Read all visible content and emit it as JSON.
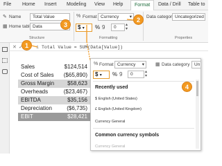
{
  "tabs": [
    "File",
    "Home",
    "Insert",
    "Modeling",
    "View",
    "Help",
    "Format",
    "Data / Drill",
    "Table to"
  ],
  "ribbon": {
    "name_label": "Name",
    "name_value": "Total Value",
    "home_table_label": "Home table",
    "home_table_value": "Data",
    "structure_label": "Structure",
    "format_label": "Format",
    "format_value": "Currency",
    "format_symbol": "$",
    "percent_symbol": "%",
    "comma_symbol": "9",
    "decimals_value": "0",
    "formatting_label": "Formatting",
    "category_label": "Data category",
    "category_value": "Uncategorized",
    "properties_label": "Properties"
  },
  "formula": {
    "line_number": "1",
    "text": "Total Value = SUM(Data[Value])"
  },
  "financials": [
    {
      "label": "Sales",
      "value": "$124,514",
      "style": "normal"
    },
    {
      "label": "Cost of Sales",
      "value": "($65,890)",
      "style": "normal"
    },
    {
      "label": "Gross Margin",
      "value": "$58,623",
      "style": "highlight"
    },
    {
      "label": "Overheads",
      "value": "($23,467)",
      "style": "normal"
    },
    {
      "label": "EBITDA",
      "value": "$35,156",
      "style": "highlight"
    },
    {
      "label": "Depreciation",
      "value": "($6,735)",
      "style": "normal"
    },
    {
      "label": "EBIT",
      "value": "$28,421",
      "style": "dark"
    }
  ],
  "callouts": [
    "1",
    "2",
    "3",
    "4"
  ],
  "panel": {
    "format_label": "Format",
    "format_value": "Currency",
    "category_label": "Data category",
    "category_value": "Un",
    "currency_symbol": "$",
    "percent_symbol": "%",
    "comma_symbol": "9",
    "decimals_value": "0",
    "recently_used_title": "Recently used",
    "recent_items": [
      "$ English (United States)",
      "£ English (United Kingdom)",
      "Currency General"
    ],
    "common_title": "Common currency symbols",
    "common_items": [
      "Currency General"
    ]
  },
  "colors": {
    "accent_orange": "#f39a21",
    "highlight_gray": "#d6d6d6",
    "ebit_gray": "#9a9a9a"
  },
  "icons": [
    "table-view-icon",
    "grid-view-icon",
    "model-view-icon",
    "dropdown-chevron-icon",
    "stepper-icon"
  ]
}
